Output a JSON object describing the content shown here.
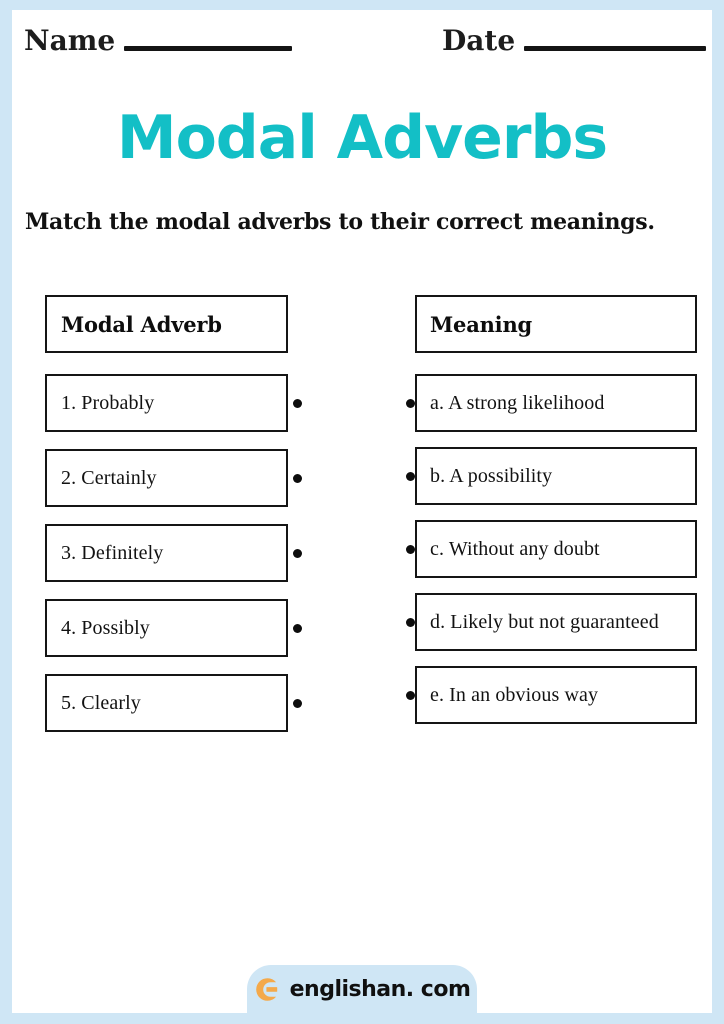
{
  "worksheet": {
    "header": {
      "name_label": "Name",
      "date_label": "Date"
    },
    "title": "Modal Adverbs",
    "instruction": "Match the modal adverbs to their correct meanings.",
    "colors": {
      "title_teal": "#13bfc6",
      "page_border_blue": "#cfe6f5",
      "logo_orange": "#f4a94a",
      "ink_black": "#121212"
    },
    "columns": {
      "left": {
        "header": "Modal Adverb",
        "items": [
          {
            "label": "1. Probably"
          },
          {
            "label": "2. Certainly"
          },
          {
            "label": "3. Definitely"
          },
          {
            "label": "4. Possibly"
          },
          {
            "label": "5. Clearly"
          }
        ]
      },
      "right": {
        "header": "Meaning",
        "items": [
          {
            "label": "a. A strong likelihood"
          },
          {
            "label": "b. A possibility"
          },
          {
            "label": "c. Without any doubt"
          },
          {
            "label": "d. Likely but not guaranteed"
          },
          {
            "label": "e. In an obvious way"
          }
        ]
      }
    },
    "footer": {
      "brand": "englishan. com",
      "logo_icon": "englishan-c-logo-icon"
    }
  }
}
